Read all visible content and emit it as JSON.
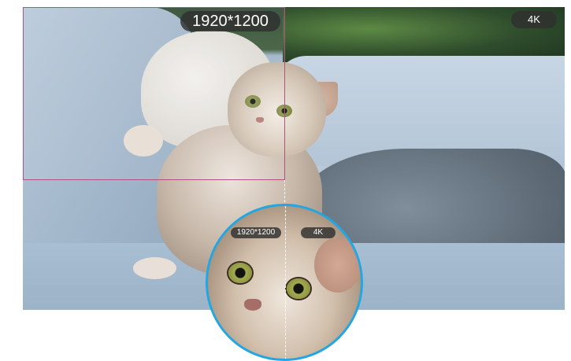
{
  "comparison": {
    "left_resolution_label": "1920*1200",
    "right_resolution_label": "4K"
  },
  "magnifier": {
    "left_resolution_label": "1920*1200",
    "right_resolution_label": "4K"
  },
  "colors": {
    "crop_border": "#b3527f",
    "magnifier_border": "#23a6e1",
    "badge_bg": "#303030"
  }
}
